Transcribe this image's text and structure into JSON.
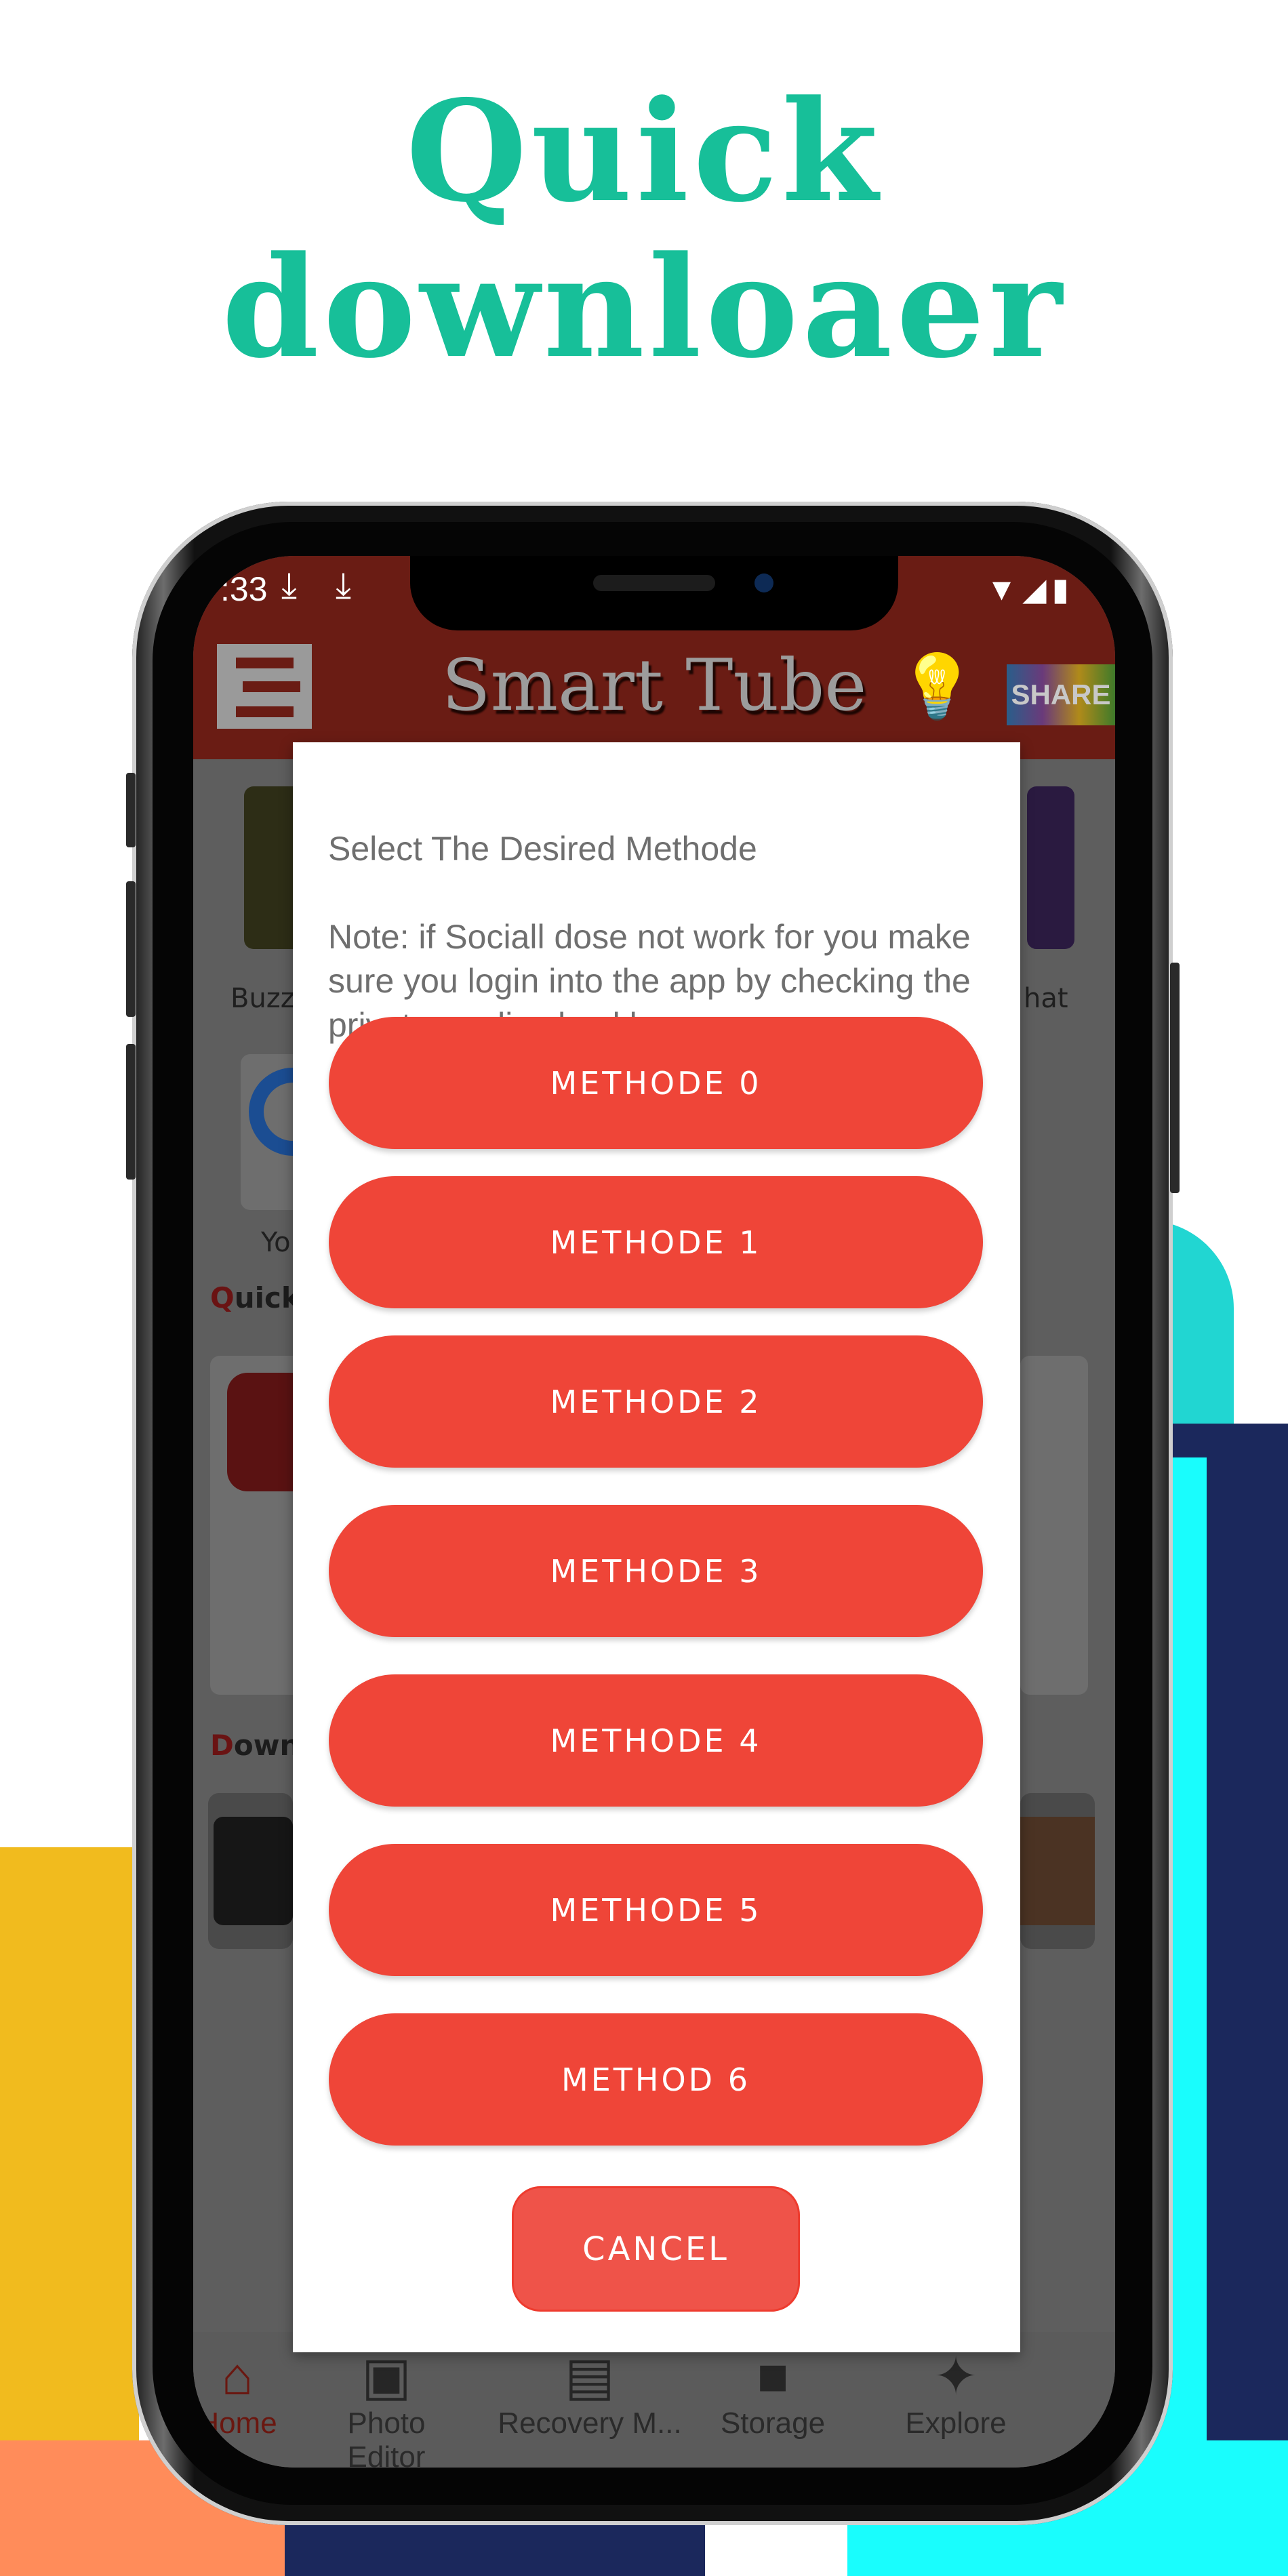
{
  "promo": {
    "title_line1": "Quick",
    "title_line2": "downloaer",
    "accent_color": "#17bf99"
  },
  "status_bar": {
    "time": ":33",
    "icons": [
      "download-icon",
      "download-icon",
      "wifi-icon",
      "signal-icon",
      "battery-charging-icon"
    ]
  },
  "app": {
    "title": "Smart Tube",
    "header_color": "#6a1c14",
    "share_label": "SHARE",
    "grid_labels": [
      "Buzz",
      "hat",
      "Yo"
    ],
    "section_quick": {
      "initial": "Q",
      "rest": "uick"
    },
    "section_download": {
      "initial": "D",
      "rest": "ownl"
    }
  },
  "dialog": {
    "message_title": "Select The Desired Methode",
    "message_note": "Note: if Sociall dose not work for you make sure you login into the app by checking the private media checkbox",
    "buttons": [
      {
        "label": "METHODE 0"
      },
      {
        "label": "METHODE 1"
      },
      {
        "label": "METHODE 2"
      },
      {
        "label": "METHODE 3"
      },
      {
        "label": "METHODE 4"
      },
      {
        "label": "METHODE 5"
      },
      {
        "label": "METHOD 6"
      }
    ],
    "cancel_label": "CANCEL",
    "button_color": "#ef4538"
  },
  "bottom_nav": {
    "items": [
      {
        "label": "Home",
        "icon": "home-icon",
        "active": true
      },
      {
        "label": "Photo Editor",
        "icon": "photo-library-icon",
        "active": false
      },
      {
        "label": "Recovery M...",
        "icon": "chat-bubble-icon",
        "active": false
      },
      {
        "label": "Storage",
        "icon": "folder-icon",
        "active": false
      },
      {
        "label": "Explore",
        "icon": "compass-icon",
        "active": false
      }
    ]
  }
}
